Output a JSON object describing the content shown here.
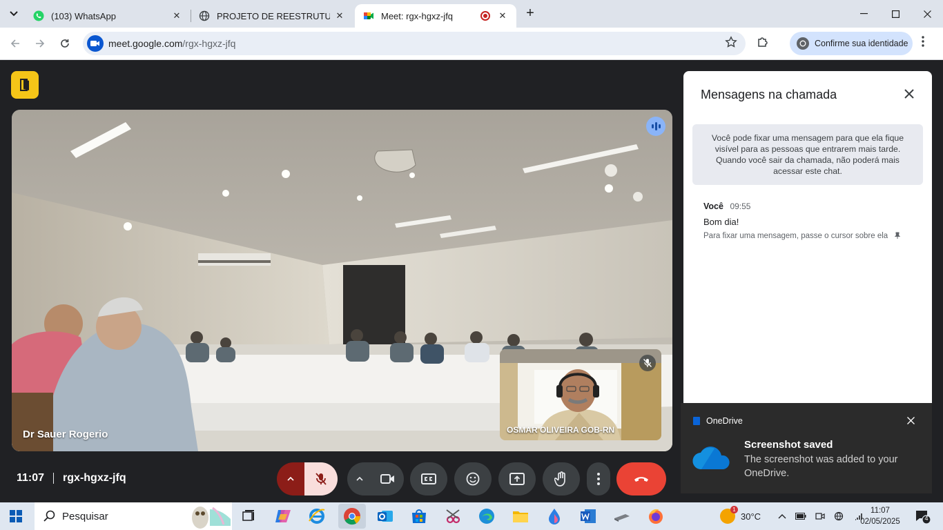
{
  "browser": {
    "tabs": [
      {
        "title": "(103) WhatsApp",
        "close": "✕"
      },
      {
        "title": "PROJETO DE REESTRUTURAÇÃO",
        "close": "✕"
      },
      {
        "title": "Meet: rgx-hgxz-jfq",
        "close": "✕"
      }
    ],
    "new_tab": "+",
    "url_host": "meet.google.com",
    "url_path": "/rgx-hgxz-jfq",
    "identity_label": "Confirme sua identidade"
  },
  "meet": {
    "main_participant": "Dr Sauer Rogerio",
    "self_participant": "OSMAR OLIVEIRA GOB-RN",
    "time": "11:07",
    "meeting_code": "rgx-hgxz-jfq"
  },
  "chat": {
    "title": "Mensagens na chamada",
    "pin_info": "Você pode fixar uma mensagem para que ela fique visível para as pessoas que entrarem mais tarde. Quando você sair da chamada, não poderá mais acessar este chat.",
    "messages": [
      {
        "sender": "Você",
        "time": "09:55",
        "text": "Bom dia!"
      }
    ],
    "pin_hint": "Para fixar uma mensagem, passe o cursor sobre ela"
  },
  "toast": {
    "app": "OneDrive",
    "title": "Screenshot saved",
    "text": "The screenshot was added to your OneDrive."
  },
  "taskbar": {
    "search_placeholder": "Pesquisar",
    "weather": "30°C",
    "weather_badge": "1",
    "clock_time": "11:07",
    "clock_date": "02/05/2025",
    "notifications": "4"
  },
  "colors": {
    "meet_bg": "#202124",
    "hangup": "#ea4335",
    "mic_off": "#f9dedc",
    "door_badge": "#f5c518"
  }
}
